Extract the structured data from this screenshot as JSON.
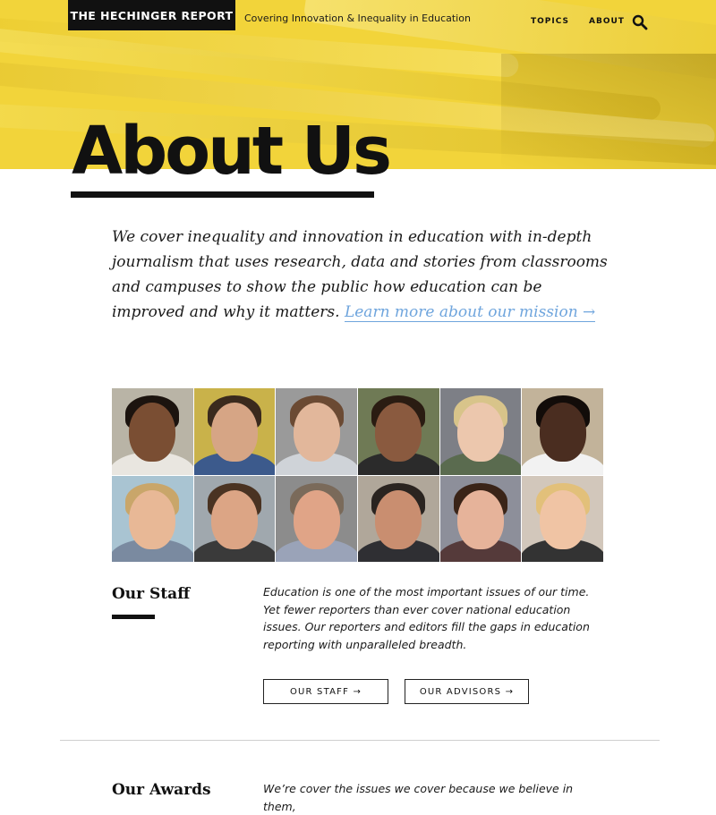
{
  "header": {
    "logo": "THE HECHINGER REPORT",
    "tagline": "Covering Innovation & Inequality in Education",
    "nav": {
      "topics": "TOPICS",
      "about": "ABOUT"
    },
    "search_icon": "search-icon"
  },
  "page": {
    "title": "About Us",
    "intro": "We cover inequality and innovation in education with in-depth journalism that uses research, data and stories from classrooms and campuses to show the public how education can be improved and why it matters.",
    "intro_link": "Learn more about our mission →"
  },
  "staff": {
    "heading": "Our Staff",
    "text": "Education is one of the most important issues of our time. Yet fewer reporters than ever cover national education issues. Our reporters and editors fill the gaps in education reporting with unparalleled breadth.",
    "button_staff": "OUR STAFF →",
    "button_advisors": "OUR ADVISORS →",
    "photos": [
      {
        "bg": "#b9b4a6",
        "skin": "#7a4e33",
        "hair": "#1c140f",
        "shirt": "#e9e6e0"
      },
      {
        "bg": "#c9b24a",
        "skin": "#d6a585",
        "hair": "#3a2a1d",
        "shirt": "#3c5a8c"
      },
      {
        "bg": "#9a9a9a",
        "skin": "#e2b79b",
        "hair": "#6b4a33",
        "shirt": "#cfd3d8"
      },
      {
        "bg": "#6f7a55",
        "skin": "#8a5a3f",
        "hair": "#2a1c12",
        "shirt": "#2b2b2b"
      },
      {
        "bg": "#7d7f86",
        "skin": "#ecc7ad",
        "hair": "#d8c48a",
        "shirt": "#5a6b4f"
      },
      {
        "bg": "#c2b39a",
        "skin": "#4a2d20",
        "hair": "#120c09",
        "shirt": "#f2f2f2"
      },
      {
        "bg": "#a9c4d2",
        "skin": "#e8b896",
        "hair": "#c9a66a",
        "shirt": "#7a8aa0"
      },
      {
        "bg": "#a0a8ae",
        "skin": "#dca585",
        "hair": "#4a3322",
        "shirt": "#3a3a3a"
      },
      {
        "bg": "#8c8c8c",
        "skin": "#e0a487",
        "hair": "#7a6a5a",
        "shirt": "#9aa3b8"
      },
      {
        "bg": "#b0a79a",
        "skin": "#c98e70",
        "hair": "#2a2420",
        "shirt": "#2f2f33"
      },
      {
        "bg": "#8d8f9a",
        "skin": "#e6b39a",
        "hair": "#3a2418",
        "shirt": "#553a3a"
      },
      {
        "bg": "#d2c7bb",
        "skin": "#f0c4a4",
        "hair": "#e2c07a",
        "shirt": "#333"
      }
    ]
  },
  "awards": {
    "heading": "Our Awards",
    "text": "We’re cover the issues we cover because we believe in them,"
  },
  "colors": {
    "accent_yellow": "#f2d43a",
    "link_blue": "#6fa5dd"
  }
}
